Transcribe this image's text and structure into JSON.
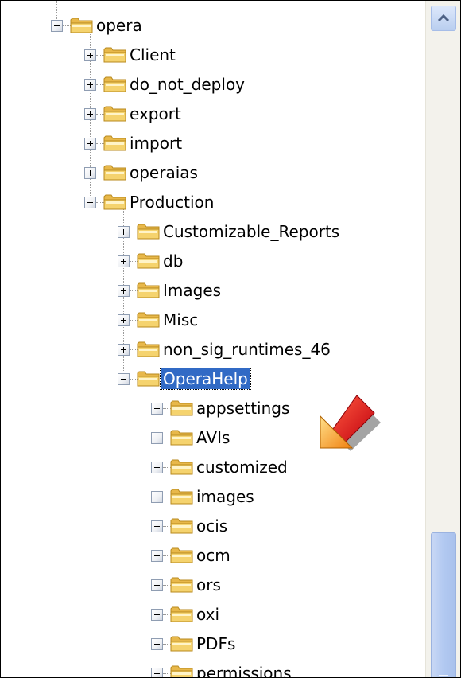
{
  "tree": {
    "items": [
      {
        "label": "opera",
        "expanded": true
      },
      {
        "label": "Client",
        "expanded": false
      },
      {
        "label": "do_not_deploy",
        "expanded": false
      },
      {
        "label": "export",
        "expanded": false
      },
      {
        "label": "import",
        "expanded": false
      },
      {
        "label": "operaias",
        "expanded": false
      },
      {
        "label": "Production",
        "expanded": true
      },
      {
        "label": "Customizable_Reports",
        "expanded": false
      },
      {
        "label": "db",
        "expanded": false
      },
      {
        "label": "Images",
        "expanded": false
      },
      {
        "label": "Misc",
        "expanded": false
      },
      {
        "label": "non_sig_runtimes_46",
        "expanded": false
      },
      {
        "label": "OperaHelp",
        "expanded": true,
        "selected": true
      },
      {
        "label": "appsettings",
        "expanded": false
      },
      {
        "label": "AVIs",
        "expanded": false
      },
      {
        "label": "customized",
        "expanded": false
      },
      {
        "label": "images",
        "expanded": false
      },
      {
        "label": "ocis",
        "expanded": false
      },
      {
        "label": "ocm",
        "expanded": false
      },
      {
        "label": "ors",
        "expanded": false
      },
      {
        "label": "oxi",
        "expanded": false
      },
      {
        "label": "PDFs",
        "expanded": false
      },
      {
        "label": "permissions",
        "expanded": false
      }
    ]
  },
  "colors": {
    "selection": "#316ac5",
    "folder": "#f5d36e",
    "arrow": "#e8141c"
  },
  "icons": {
    "folder": "folder-icon",
    "expand": "plus-icon",
    "collapse": "minus-icon",
    "pointer": "pointer-arrow-icon",
    "scroll_up": "chevron-up-icon"
  }
}
